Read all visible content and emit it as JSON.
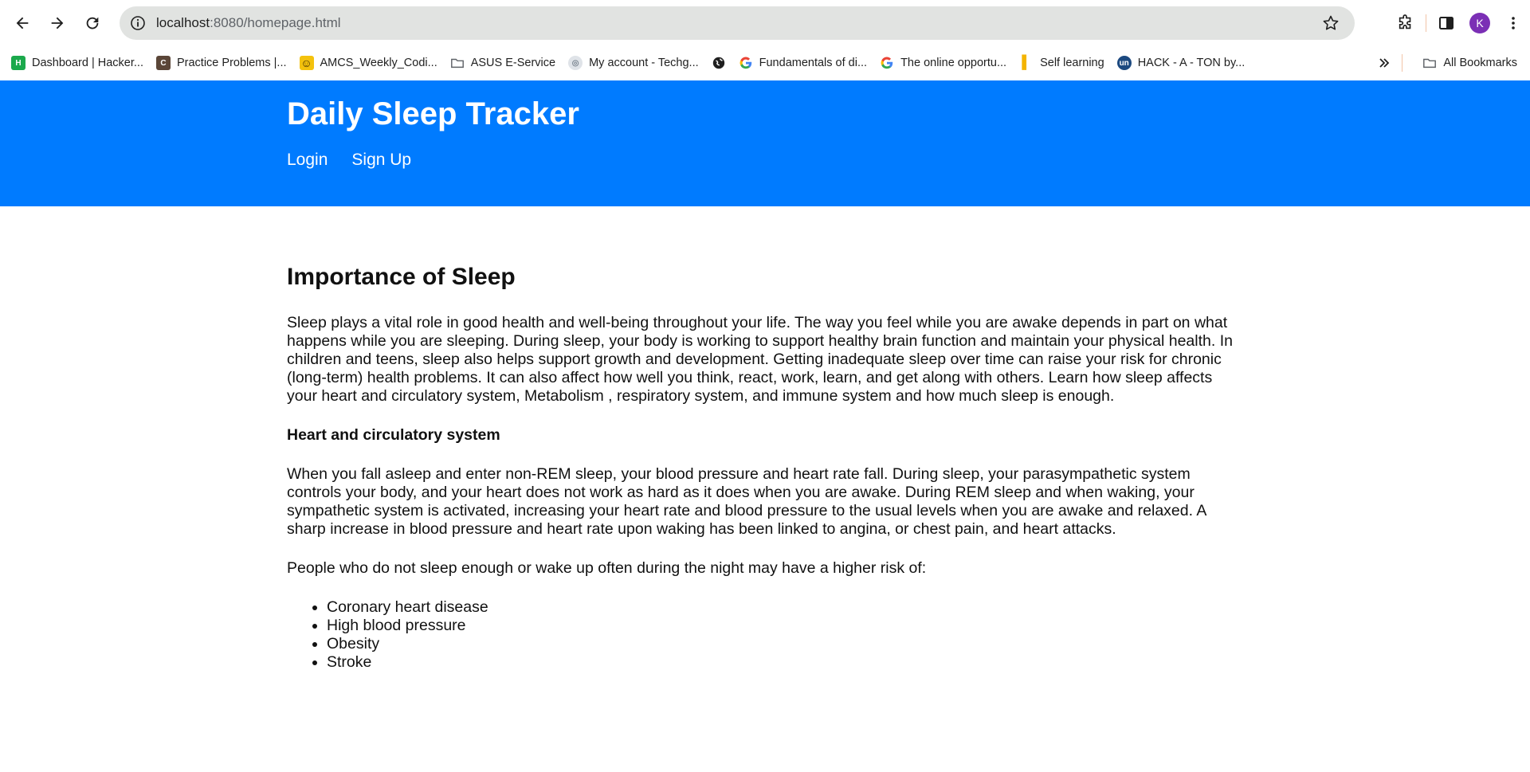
{
  "browser": {
    "url_host": "localhost",
    "url_path": ":8080/homepage.html",
    "avatar_letter": "K",
    "bookmarks": [
      {
        "label": "Dashboard | Hacker...",
        "icon": "hackerrank-icon",
        "color": "#1ba94c"
      },
      {
        "label": "Practice Problems |...",
        "icon": "codechef-icon",
        "color": "#5b4638"
      },
      {
        "label": "AMCS_Weekly_Codi...",
        "icon": "smiley-icon",
        "color": "#f4c20d"
      },
      {
        "label": "ASUS E-Service",
        "icon": "folder-icon",
        "color": "#5f6368"
      },
      {
        "label": "My account - Techg...",
        "icon": "techgig-icon",
        "color": "#9aa0a6"
      },
      {
        "label": "",
        "icon": "globe-icon",
        "color": "#1f1f1f"
      },
      {
        "label": "Fundamentals of di...",
        "icon": "google-icon",
        "color": "#4285f4"
      },
      {
        "label": "The online opportu...",
        "icon": "google-icon",
        "color": "#4285f4"
      },
      {
        "label": "Self learning",
        "icon": "bar-chart-icon",
        "color": "#f4b400"
      },
      {
        "label": "HACK - A - TON by...",
        "icon": "unstop-icon",
        "color": "#1c4980"
      }
    ],
    "all_bookmarks_label": "All Bookmarks"
  },
  "header": {
    "title": "Daily Sleep Tracker",
    "nav": [
      "Login",
      "Sign Up"
    ],
    "bg_color": "#007bff"
  },
  "main": {
    "heading": "Importance of Sleep",
    "intro": "Sleep plays a vital role in good health and well-being throughout your life. The way you feel while you are awake depends in part on what happens while you are sleeping. During sleep, your body is working to support healthy brain function and maintain your physical health. In children and teens, sleep also helps support growth and development. Getting inadequate sleep over time can raise your risk for chronic (long-term) health problems. It can also affect how well you think, react, work, learn, and get along with others. Learn how sleep affects your heart and circulatory system, Metabolism , respiratory system, and immune system and how much sleep is enough.",
    "subheading": "Heart and circulatory system",
    "para2": "When you fall asleep and enter non-REM sleep, your blood pressure and heart rate fall. During sleep, your parasympathetic system controls your body, and your heart does not work as hard as it does when you are awake. During REM sleep and when waking, your sympathetic system is activated, increasing your heart rate and blood pressure to the usual levels when you are awake and relaxed. A sharp increase in blood pressure and heart rate upon waking has been linked to angina, or chest pain, and heart attacks.",
    "para3": "People who do not sleep enough or wake up often during the night may have a higher risk of:",
    "risks": [
      "Coronary heart disease",
      "High blood pressure",
      "Obesity",
      "Stroke"
    ]
  }
}
